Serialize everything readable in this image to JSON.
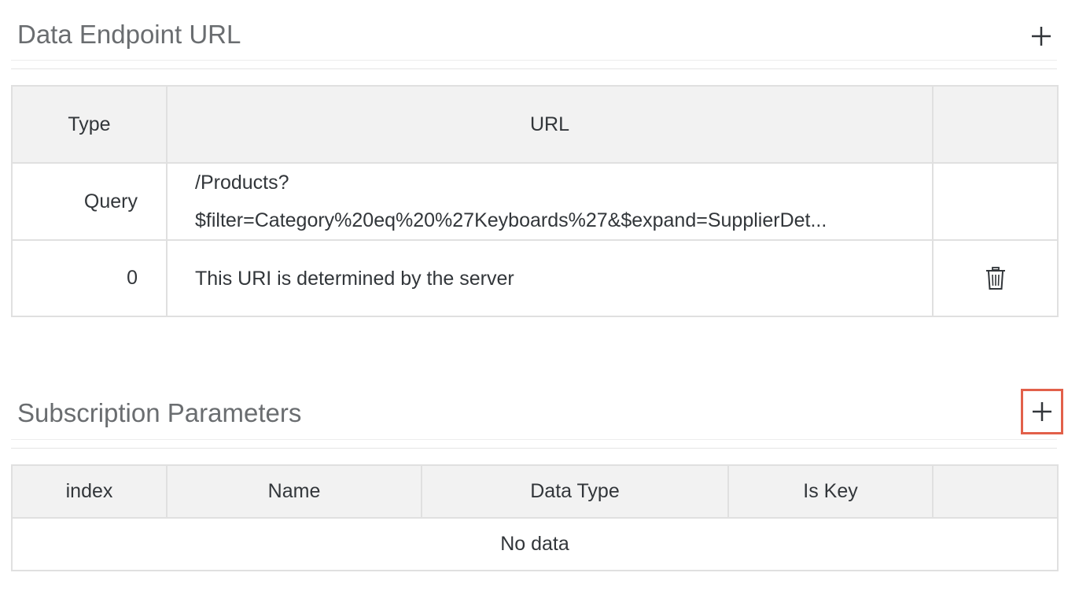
{
  "endpoint_section": {
    "title": "Data Endpoint URL",
    "add_icon": "plus-icon",
    "columns": [
      "Type",
      "URL",
      ""
    ],
    "rows": [
      {
        "type": "Query",
        "url_line1": "/Products?",
        "url_line2": "$filter=Category%20eq%20%27Keyboards%27&$expand=SupplierDet...",
        "action_icon": ""
      },
      {
        "type": "0",
        "url_line1": "This URI is determined by the server",
        "url_line2": "",
        "action_icon": "trash-icon"
      }
    ]
  },
  "subscription_section": {
    "title": "Subscription Parameters",
    "add_icon": "plus-icon",
    "highlight_color": "#e2604a",
    "columns": [
      "index",
      "Name",
      "Data Type",
      "Is Key",
      ""
    ],
    "empty_text": "No data"
  }
}
